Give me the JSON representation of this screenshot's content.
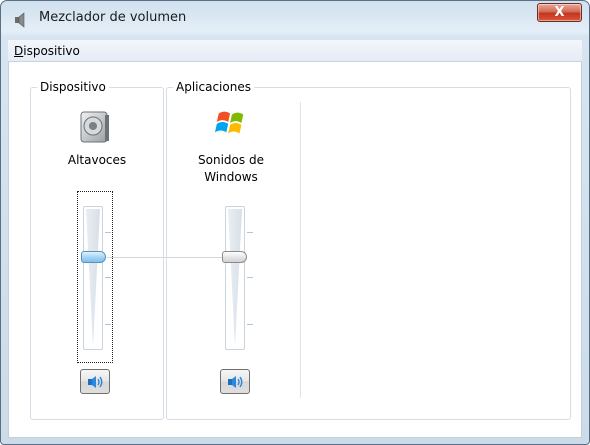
{
  "window": {
    "title": "Mezclador de volumen",
    "close_label": "X"
  },
  "menu": {
    "items": [
      {
        "accel": "D",
        "rest": "ispositivo"
      }
    ]
  },
  "device_group": {
    "title": "Dispositivo",
    "device_name": "Altavoces",
    "icon": "speaker-device-icon",
    "volume_percent": 65,
    "focused": true
  },
  "apps_group": {
    "title": "Aplicaciones",
    "apps": [
      {
        "name_line1": "Sonidos de",
        "name_line2": "Windows",
        "icon": "windows-logo-icon",
        "volume_percent": 65
      }
    ]
  },
  "colors": {
    "accent": "#7fc0ea",
    "close_button": "#c2361e"
  }
}
